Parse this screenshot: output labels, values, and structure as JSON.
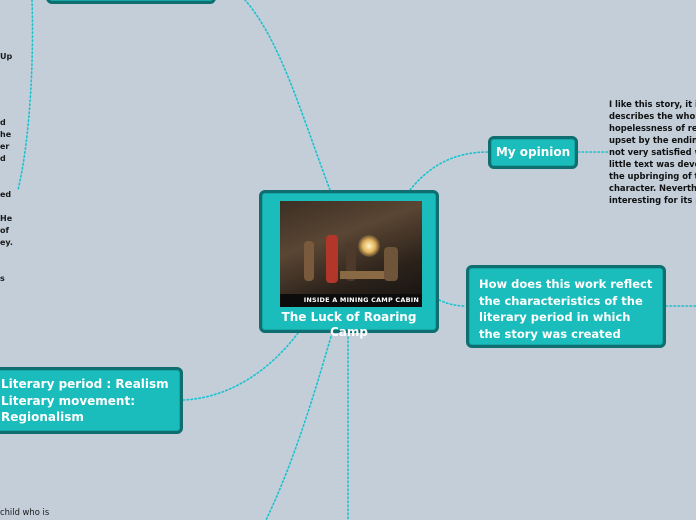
{
  "central_node": {
    "title": "The Luck of Roaring Camp",
    "image_caption": "INSIDE A MINING CAMP CABIN"
  },
  "branches": {
    "opinion": {
      "label": "My opinion",
      "note_lines": [
        "I like this story, it is",
        "describes the whole",
        "hopelessness of res",
        "upset by the ending",
        "not very satisfied w",
        "little text was devot",
        "the upbringing of th",
        "character. Neverthe",
        "interesting for its p"
      ]
    },
    "reflect": {
      "label": "How does this work reflect the characteristics of the literary period in which the story was created"
    },
    "period": {
      "label_line1": "Literary  period : Realism",
      "label_line2": "Literary movement:",
      "label_line3": "Regionalism"
    }
  },
  "left_fragments": {
    "f1": "Up",
    "f2": "d",
    "f3": "he",
    "f4": "er",
    "f5": "d",
    "f6": "ed",
    "f7": "He",
    "f8": "of",
    "f9": "ey.",
    "f10": "s",
    "bottom": "child who is"
  },
  "colors": {
    "background": "#c3ced9",
    "node_fill": "#1bbcbc",
    "node_border": "#0f6f70",
    "connector": "#19c2cf"
  }
}
